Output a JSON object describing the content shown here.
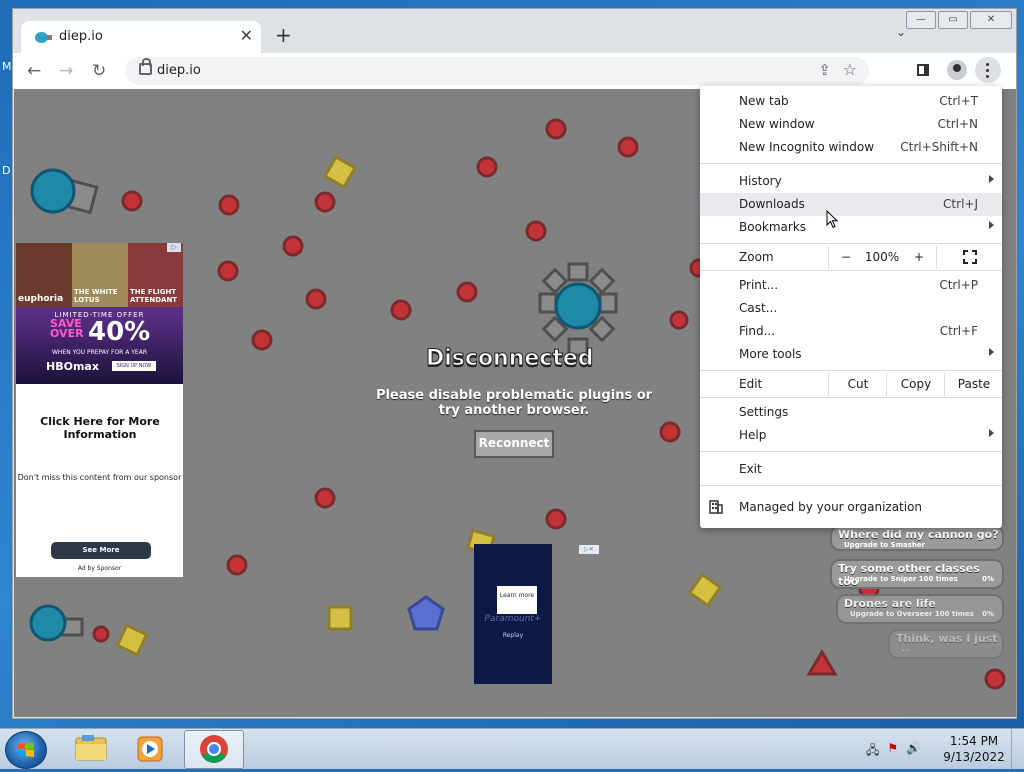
{
  "desktop": {
    "left_letters": [
      "M",
      "D"
    ]
  },
  "window": {
    "controls": [
      "—",
      "▭",
      "✕"
    ],
    "tab": {
      "title": "diep.io",
      "close": "✕"
    },
    "new_tab": "+",
    "tab_search": "⌄",
    "address": "diep.io"
  },
  "game": {
    "title": "Disconnected",
    "message": "Please disable problematic plugins or try another browser.",
    "reconnect": "Reconnect",
    "achievements": [
      {
        "title": "Where did my cannon go?",
        "sub": "Upgrade to Smasher",
        "progress": ""
      },
      {
        "title": "Try some other classes too",
        "sub": "Upgrade to Sniper 100 times",
        "progress": "0%"
      },
      {
        "title": "Drones are life",
        "sub": "Upgrade to Overseer 100 times",
        "progress": "0%"
      },
      {
        "title": "Think, was I just",
        "sub": "...",
        "progress": ""
      }
    ]
  },
  "ads": {
    "left": {
      "posters": [
        "euphoria",
        "THE WHITE LOTUS",
        "THE FLIGHT ATTENDANT"
      ],
      "limited": "LIMITED-TIME OFFER",
      "save": "SAVE OVER",
      "percent": "40%",
      "prepay": "WHEN YOU PREPAY FOR A YEAR",
      "brand": "HBOmax",
      "signup": "SIGN UP NOW",
      "adchoices": "▷",
      "click_text": "Click Here for More Information",
      "dont_miss": "Don't miss this content from our sponsor",
      "see_more": "See More",
      "ad_by": "Ad by Sponsor"
    },
    "center": {
      "learn": "Learn more",
      "brand": "Paramount+",
      "replay": "Replay",
      "close": "▷✕"
    }
  },
  "menu": {
    "items": [
      {
        "label": "New tab",
        "shortcut": "Ctrl+T"
      },
      {
        "label": "New window",
        "shortcut": "Ctrl+N"
      },
      {
        "label": "New Incognito window",
        "shortcut": "Ctrl+Shift+N"
      },
      {
        "label": "History",
        "shortcut": ""
      },
      {
        "label": "Downloads",
        "shortcut": "Ctrl+J"
      },
      {
        "label": "Bookmarks",
        "shortcut": ""
      },
      {
        "label": "Print...",
        "shortcut": "Ctrl+P"
      },
      {
        "label": "Cast...",
        "shortcut": ""
      },
      {
        "label": "Find...",
        "shortcut": "Ctrl+F"
      },
      {
        "label": "More tools",
        "shortcut": ""
      },
      {
        "label": "Settings",
        "shortcut": ""
      },
      {
        "label": "Help",
        "shortcut": ""
      },
      {
        "label": "Exit",
        "shortcut": ""
      },
      {
        "label": "Managed by your organization",
        "shortcut": ""
      }
    ],
    "zoom": {
      "label": "Zoom",
      "minus": "−",
      "value": "100%",
      "plus": "+"
    },
    "edit": {
      "label": "Edit",
      "cut": "Cut",
      "copy": "Copy",
      "paste": "Paste"
    }
  },
  "taskbar": {
    "time": "1:54 PM",
    "date": "9/13/2022"
  }
}
